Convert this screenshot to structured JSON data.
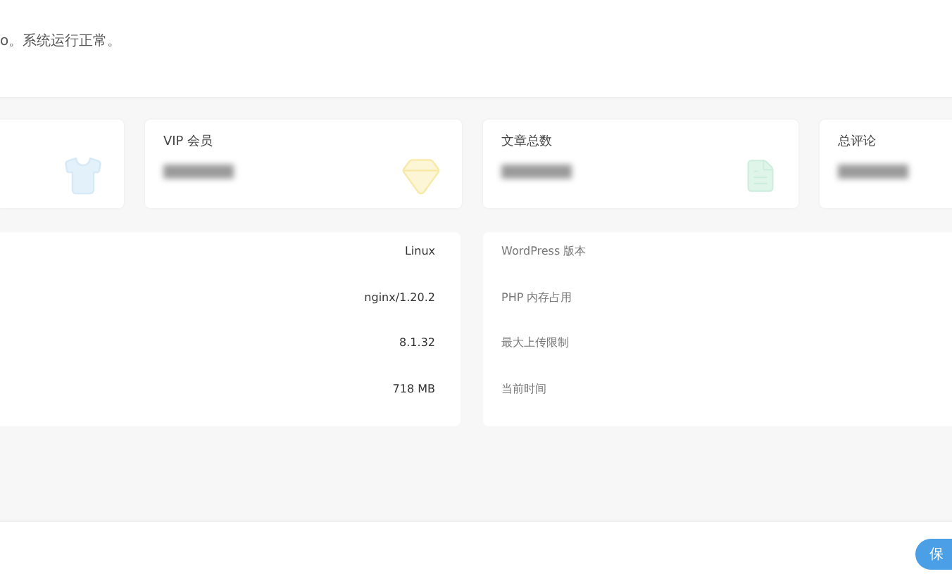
{
  "status_message": "o。系统运行正常。",
  "stat_cards": [
    {
      "kind": "shirt"
    },
    {
      "kind": "gem",
      "label": "VIP 会员"
    },
    {
      "kind": "file",
      "label": "文章总数"
    },
    {
      "kind": "none",
      "label": "总评论"
    }
  ],
  "server_info": {
    "rows": [
      {
        "value": "Linux"
      },
      {
        "value": "nginx/1.20.2"
      },
      {
        "value": "8.1.32"
      },
      {
        "value": "718 MB"
      }
    ]
  },
  "site_info": {
    "rows": [
      {
        "label": "WordPress 版本"
      },
      {
        "label": "PHP 内存占用"
      },
      {
        "label": "最大上传限制"
      },
      {
        "label": "当前时间"
      }
    ]
  },
  "save_button": {
    "label": "保"
  }
}
